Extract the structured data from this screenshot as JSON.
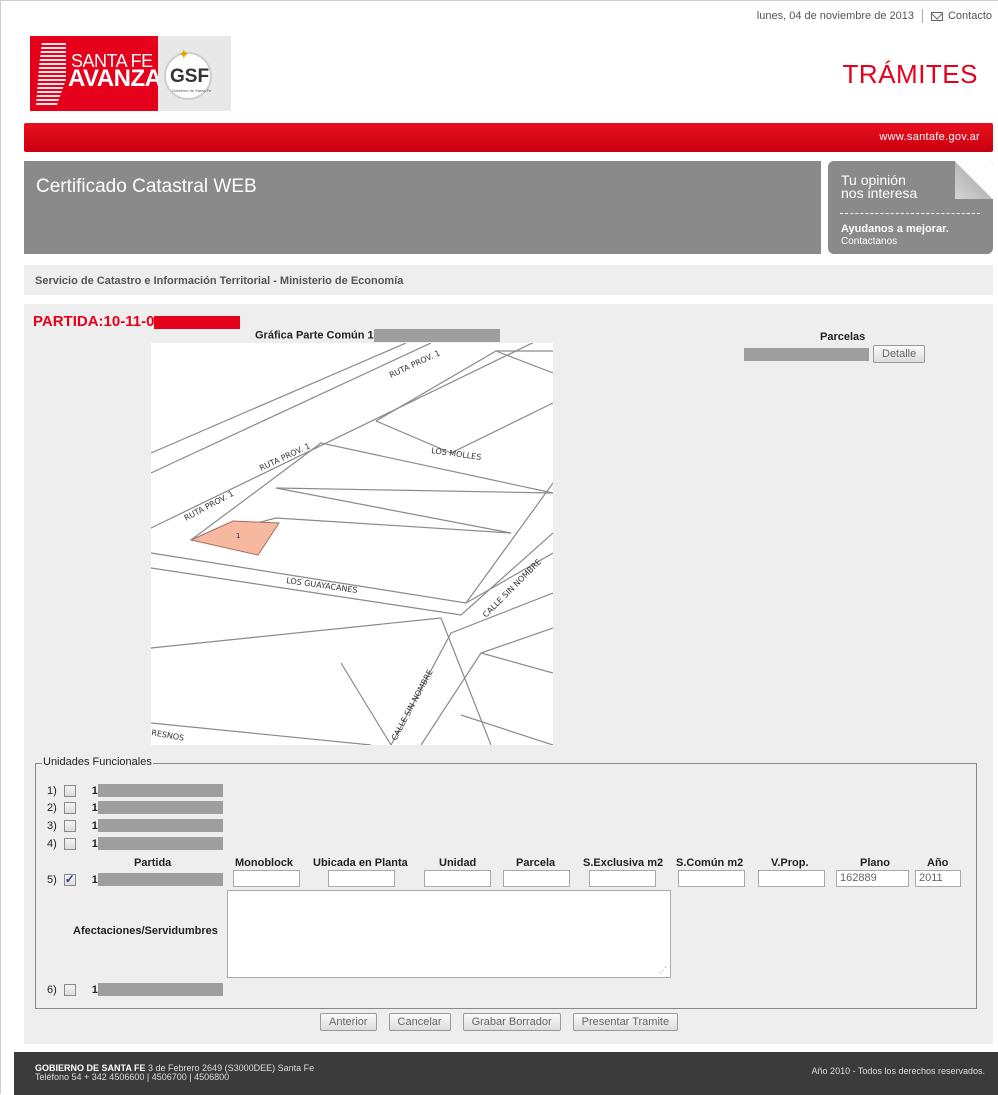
{
  "header": {
    "date": "lunes, 04 de noviembre de 2013",
    "contact_label": "Contacto",
    "logo_santafe_line1": "SANTA FE",
    "logo_santafe_line2": "AVANZA",
    "logo_gsf": "GSF",
    "logo_gsf_small": "Gobierno de Santa Fe",
    "section_title": "TRÁMITES",
    "site_url": "www.santafe.gov.ar"
  },
  "banner": {
    "title": "Certificado Catastral WEB",
    "opinion_line1": "Tu opinión",
    "opinion_line2": "nos interesa",
    "opinion_cta": "Ayudanos a mejorar.",
    "opinion_link": "Contactanos"
  },
  "subtitle": "Servicio de Catastro e Información Territorial - Ministerio de Economía",
  "record": {
    "partida_prefix": "PARTIDA:10-11-0",
    "grafica_label": "Gráfica  Parte Común 1",
    "parcelas_label": "Parcelas",
    "detalle_button": "Detalle"
  },
  "map": {
    "labels": [
      "RUTA PROV. 1",
      "RUTA PROV. 1",
      "RUTA PROV. 1",
      "LOS MOLLES",
      "LOS GUAYACANES",
      "CALLE SIN NOMBRE",
      "CALLE SIN NOMBRE",
      "RESNOS"
    ],
    "parcel_number": "1",
    "highlight_color": "#f7b8a0"
  },
  "unidades": {
    "legend": "Unidades Funcionales",
    "rows": [
      {
        "index": "1)",
        "prefix": "1",
        "checked": false
      },
      {
        "index": "2)",
        "prefix": "1",
        "checked": false
      },
      {
        "index": "3)",
        "prefix": "1",
        "checked": false
      },
      {
        "index": "4)",
        "prefix": "1",
        "checked": false
      },
      {
        "index": "5)",
        "prefix": "1",
        "checked": true
      },
      {
        "index": "6)",
        "prefix": "1",
        "checked": false
      }
    ],
    "columns": [
      "Partida",
      "Monoblock",
      "Ubicada en Planta",
      "Unidad",
      "Parcela",
      "S.Exclusiva m2",
      "S.Común m2",
      "V.Prop.",
      "Plano",
      "Año"
    ],
    "values": {
      "monoblock": "",
      "planta": "",
      "unidad": "",
      "parcela": "",
      "sexclusiva": "",
      "scomun": "",
      "vprop": "",
      "plano": "162889",
      "anio": "2011"
    },
    "afectaciones_label": "Afectaciones/Servidumbres",
    "afectaciones_value": ""
  },
  "actions": [
    "Anterior",
    "Cancelar",
    "Grabar Borrador",
    "Presentar Tramite"
  ],
  "footer": {
    "org": "GOBIERNO DE SANTA FE",
    "address": " 3 de Febrero 2649 (S3000DEE) Santa Fe",
    "phone": "Teléfono 54 + 342 4506600 | 4506700 | 4506800",
    "rights": "Año 2010 - Todos los derechos reservados."
  },
  "colors": {
    "brand_red": "#e5001c",
    "panel_gray": "#8a8a8a",
    "footer": "#3b3b3b"
  }
}
